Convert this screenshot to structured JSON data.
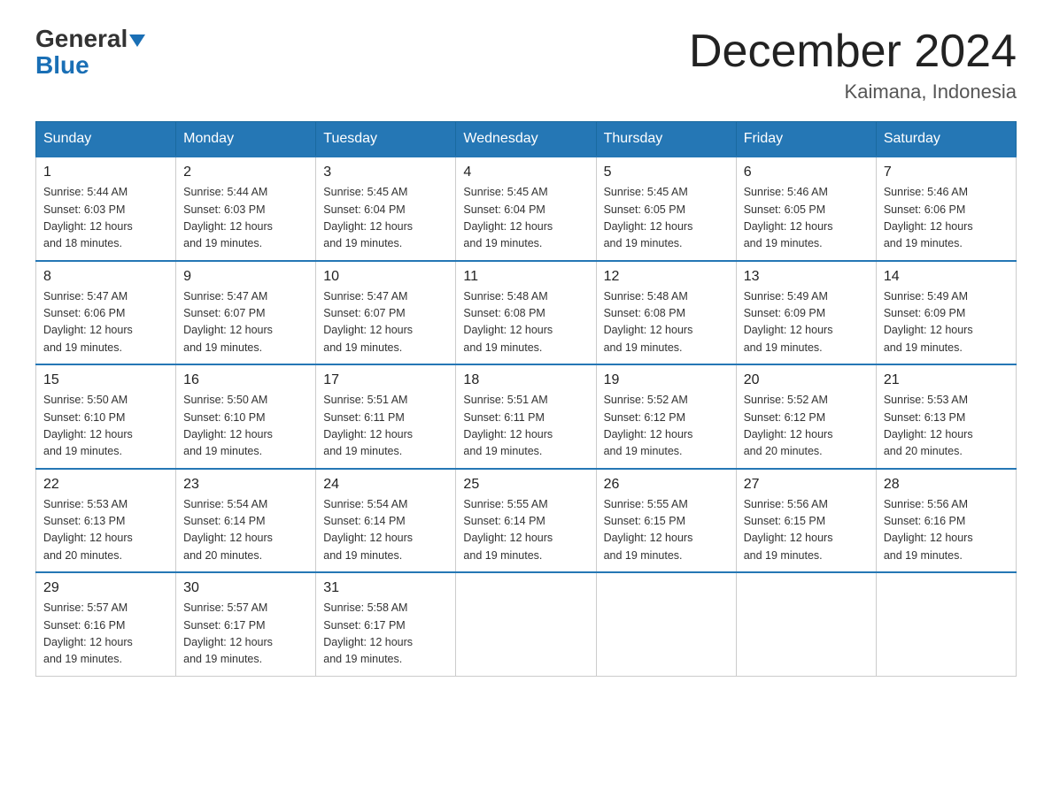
{
  "logo": {
    "general": "General",
    "triangle": "▲",
    "blue": "Blue"
  },
  "title": "December 2024",
  "location": "Kaimana, Indonesia",
  "weekdays": [
    "Sunday",
    "Monday",
    "Tuesday",
    "Wednesday",
    "Thursday",
    "Friday",
    "Saturday"
  ],
  "weeks": [
    [
      {
        "day": "1",
        "sunrise": "5:44 AM",
        "sunset": "6:03 PM",
        "daylight": "12 hours and 18 minutes."
      },
      {
        "day": "2",
        "sunrise": "5:44 AM",
        "sunset": "6:03 PM",
        "daylight": "12 hours and 19 minutes."
      },
      {
        "day": "3",
        "sunrise": "5:45 AM",
        "sunset": "6:04 PM",
        "daylight": "12 hours and 19 minutes."
      },
      {
        "day": "4",
        "sunrise": "5:45 AM",
        "sunset": "6:04 PM",
        "daylight": "12 hours and 19 minutes."
      },
      {
        "day": "5",
        "sunrise": "5:45 AM",
        "sunset": "6:05 PM",
        "daylight": "12 hours and 19 minutes."
      },
      {
        "day": "6",
        "sunrise": "5:46 AM",
        "sunset": "6:05 PM",
        "daylight": "12 hours and 19 minutes."
      },
      {
        "day": "7",
        "sunrise": "5:46 AM",
        "sunset": "6:06 PM",
        "daylight": "12 hours and 19 minutes."
      }
    ],
    [
      {
        "day": "8",
        "sunrise": "5:47 AM",
        "sunset": "6:06 PM",
        "daylight": "12 hours and 19 minutes."
      },
      {
        "day": "9",
        "sunrise": "5:47 AM",
        "sunset": "6:07 PM",
        "daylight": "12 hours and 19 minutes."
      },
      {
        "day": "10",
        "sunrise": "5:47 AM",
        "sunset": "6:07 PM",
        "daylight": "12 hours and 19 minutes."
      },
      {
        "day": "11",
        "sunrise": "5:48 AM",
        "sunset": "6:08 PM",
        "daylight": "12 hours and 19 minutes."
      },
      {
        "day": "12",
        "sunrise": "5:48 AM",
        "sunset": "6:08 PM",
        "daylight": "12 hours and 19 minutes."
      },
      {
        "day": "13",
        "sunrise": "5:49 AM",
        "sunset": "6:09 PM",
        "daylight": "12 hours and 19 minutes."
      },
      {
        "day": "14",
        "sunrise": "5:49 AM",
        "sunset": "6:09 PM",
        "daylight": "12 hours and 19 minutes."
      }
    ],
    [
      {
        "day": "15",
        "sunrise": "5:50 AM",
        "sunset": "6:10 PM",
        "daylight": "12 hours and 19 minutes."
      },
      {
        "day": "16",
        "sunrise": "5:50 AM",
        "sunset": "6:10 PM",
        "daylight": "12 hours and 19 minutes."
      },
      {
        "day": "17",
        "sunrise": "5:51 AM",
        "sunset": "6:11 PM",
        "daylight": "12 hours and 19 minutes."
      },
      {
        "day": "18",
        "sunrise": "5:51 AM",
        "sunset": "6:11 PM",
        "daylight": "12 hours and 19 minutes."
      },
      {
        "day": "19",
        "sunrise": "5:52 AM",
        "sunset": "6:12 PM",
        "daylight": "12 hours and 19 minutes."
      },
      {
        "day": "20",
        "sunrise": "5:52 AM",
        "sunset": "6:12 PM",
        "daylight": "12 hours and 20 minutes."
      },
      {
        "day": "21",
        "sunrise": "5:53 AM",
        "sunset": "6:13 PM",
        "daylight": "12 hours and 20 minutes."
      }
    ],
    [
      {
        "day": "22",
        "sunrise": "5:53 AM",
        "sunset": "6:13 PM",
        "daylight": "12 hours and 20 minutes."
      },
      {
        "day": "23",
        "sunrise": "5:54 AM",
        "sunset": "6:14 PM",
        "daylight": "12 hours and 20 minutes."
      },
      {
        "day": "24",
        "sunrise": "5:54 AM",
        "sunset": "6:14 PM",
        "daylight": "12 hours and 19 minutes."
      },
      {
        "day": "25",
        "sunrise": "5:55 AM",
        "sunset": "6:14 PM",
        "daylight": "12 hours and 19 minutes."
      },
      {
        "day": "26",
        "sunrise": "5:55 AM",
        "sunset": "6:15 PM",
        "daylight": "12 hours and 19 minutes."
      },
      {
        "day": "27",
        "sunrise": "5:56 AM",
        "sunset": "6:15 PM",
        "daylight": "12 hours and 19 minutes."
      },
      {
        "day": "28",
        "sunrise": "5:56 AM",
        "sunset": "6:16 PM",
        "daylight": "12 hours and 19 minutes."
      }
    ],
    [
      {
        "day": "29",
        "sunrise": "5:57 AM",
        "sunset": "6:16 PM",
        "daylight": "12 hours and 19 minutes."
      },
      {
        "day": "30",
        "sunrise": "5:57 AM",
        "sunset": "6:17 PM",
        "daylight": "12 hours and 19 minutes."
      },
      {
        "day": "31",
        "sunrise": "5:58 AM",
        "sunset": "6:17 PM",
        "daylight": "12 hours and 19 minutes."
      },
      null,
      null,
      null,
      null
    ]
  ],
  "labels": {
    "sunrise_prefix": "Sunrise: ",
    "sunset_prefix": "Sunset: ",
    "daylight_prefix": "Daylight: "
  }
}
